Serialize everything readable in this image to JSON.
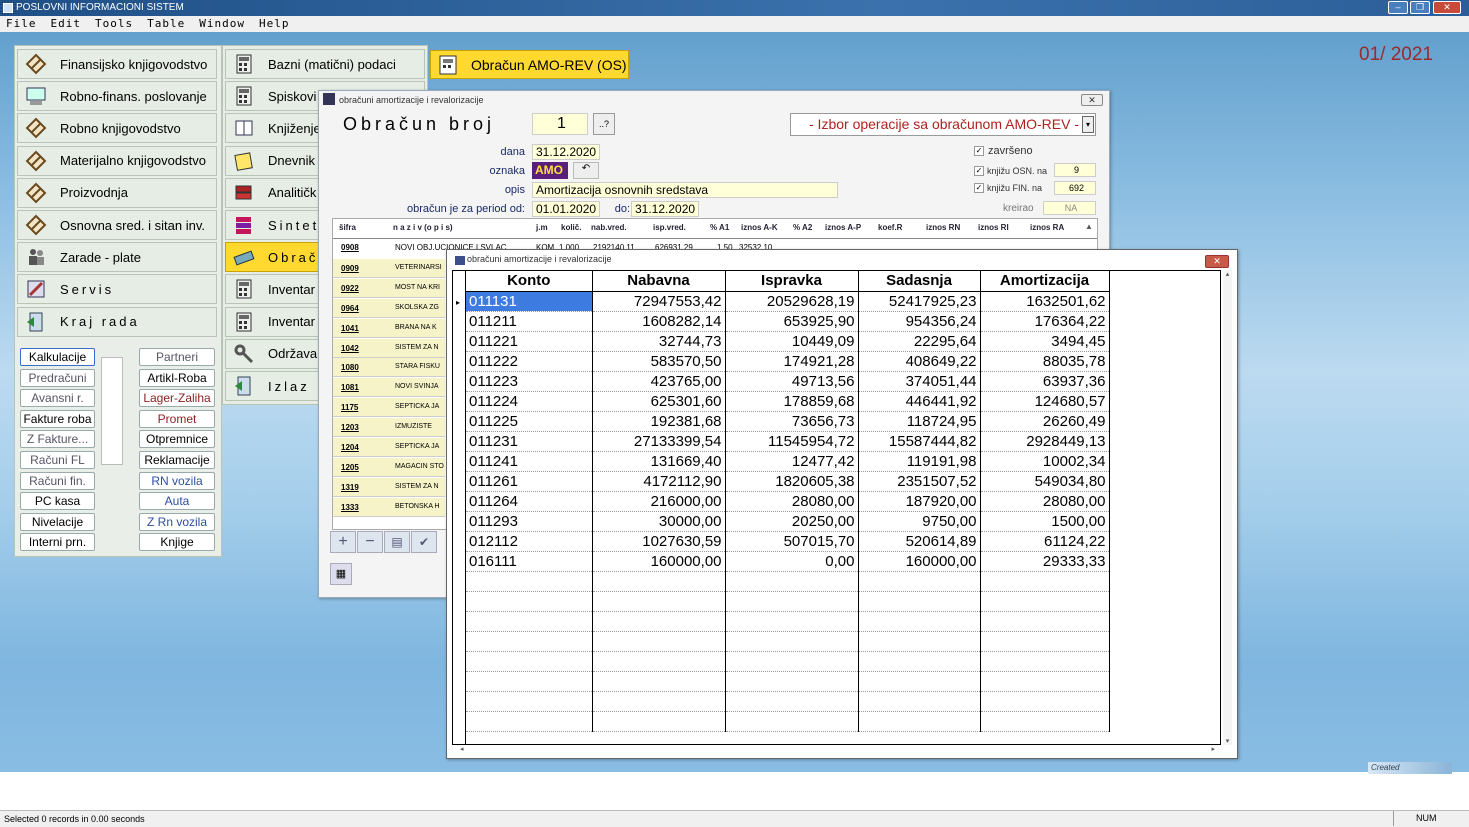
{
  "app": {
    "title": "POSLOVNI INFORMACIONI SISTEM",
    "period": "01/ 2021"
  },
  "menu": [
    "File",
    "Edit",
    "Tools",
    "Table",
    "Window",
    "Help"
  ],
  "col1": [
    {
      "label": "Finansijsko knjigovodstvo",
      "icon": "diamond-icon"
    },
    {
      "label": "Robno-finans. poslovanje",
      "icon": "computer-icon"
    },
    {
      "label": "Robno knjigovodstvo",
      "icon": "diamond-icon"
    },
    {
      "label": "Materijalno knjigovodstvo",
      "icon": "diamond-icon"
    },
    {
      "label": "Proizvodnja",
      "icon": "diamond-icon"
    },
    {
      "label": "Osnovna sred. i sitan inv.",
      "icon": "diamond-icon"
    },
    {
      "label": "Zarade - plate",
      "icon": "people-icon"
    },
    {
      "label": "Servis",
      "icon": "tools-icon"
    },
    {
      "label": "Kraj rada",
      "icon": "exit-icon"
    }
  ],
  "col2": [
    {
      "label": "Bazni (matični) podaci",
      "icon": "calculator-icon"
    },
    {
      "label": "Spiskovi",
      "icon": "calculator-icon"
    },
    {
      "label": "Knjiženje",
      "icon": "book-icon"
    },
    {
      "label": "Dnevnik",
      "icon": "notebook-icon"
    },
    {
      "label": "Analitičk",
      "icon": "books-icon"
    },
    {
      "label": "Sintet",
      "icon": "books-stack-icon"
    },
    {
      "label": "Obrač",
      "icon": "pen-icon"
    },
    {
      "label": "Inventar",
      "icon": "calculator-icon"
    },
    {
      "label": "Inventar",
      "icon": "calculator-icon"
    },
    {
      "label": "Održavan",
      "icon": "wrench-icon"
    },
    {
      "label": "Izlaz",
      "icon": "exit-icon"
    }
  ],
  "obracun_btn": "Obračun  AMO-REV (OS)",
  "small_left": [
    "Kalkulacije",
    "Predračuni",
    "Avansni r.",
    "Fakture roba",
    "Z Fakture...",
    "Računi FL",
    "Računi fin.",
    "PC kasa",
    "Nivelacije",
    "Interni prn."
  ],
  "small_right": [
    "Partneri",
    "Artikl-Roba",
    "Lager-Zaliha",
    "Promet",
    "Otpremnice",
    "Reklamacije",
    "RN vozila",
    "Auta",
    "Z Rn vozila",
    "Knjige"
  ],
  "back_win": {
    "title": "obračuni amortizacije i revalorizacije",
    "heading": "Obračun broj",
    "number": "1",
    "q": "..?",
    "combo": "- Izbor operacije sa obračunom AMO-REV -",
    "dana_l": "dana",
    "dana": "31.12.2020",
    "oznaka_l": "oznaka",
    "oznaka": "AMO",
    "opis_l": "opis",
    "opis": "Amortizacija osnovnih sredstava",
    "period_l": "obračun je za period od:",
    "od": "01.01.2020",
    "do_l": "do:",
    "do": "31.12.2020",
    "zavrseno": "završeno",
    "osn_l": "knjižu OSN. na",
    "osn": "9",
    "fin_l": "knjižu FIN. na",
    "fin": "692",
    "kreirao_l": "kreirao",
    "kreirao": "NA",
    "cols": [
      "šifra",
      "n a z i v  (o p i s)",
      "j.m",
      "količ.",
      "nab.vred.",
      "isp.vred.",
      "% A1",
      "iznos A-K",
      "% A2",
      "iznos A-P",
      "koef.R",
      "iznos RN",
      "iznos RI",
      "iznos RA"
    ],
    "first_row": [
      "0908",
      "NOVI OBJ.UCIONICE I SVLAC",
      "KOM",
      "1,000",
      "2192140,11",
      "626931,29",
      "1,50",
      "32532,10"
    ],
    "rows": [
      [
        "0909",
        "VETERINARSI"
      ],
      [
        "0922",
        "MOST NA KRI"
      ],
      [
        "0964",
        "SKOLSKA ZG"
      ],
      [
        "1041",
        "BRANA NA K"
      ],
      [
        "1042",
        "SISTEM ZA N"
      ],
      [
        "1080",
        "STARA FISKU"
      ],
      [
        "1081",
        "NOVI SVINJA"
      ],
      [
        "1175",
        "SEPTICKA JA"
      ],
      [
        "1203",
        "IZMUZISTE"
      ],
      [
        "1204",
        "SEPTICKA JA"
      ],
      [
        "1205",
        "MAGACIN STO"
      ],
      [
        "1319",
        "SISTEM ZA N"
      ],
      [
        "1333",
        "BETONSKA H"
      ]
    ]
  },
  "front_win": {
    "title": "obračuni amortizacije i revalorizacije",
    "cols": [
      "Konto",
      "Nabavna",
      "Ispravka",
      "Sadasnja",
      "Amortizacija"
    ],
    "rows": [
      [
        "011131",
        "72947553,42",
        "20529628,19",
        "52417925,23",
        "1632501,62"
      ],
      [
        "011211",
        "1608282,14",
        "653925,90",
        "954356,24",
        "176364,22"
      ],
      [
        "011221",
        "32744,73",
        "10449,09",
        "22295,64",
        "3494,45"
      ],
      [
        "011222",
        "583570,50",
        "174921,28",
        "408649,22",
        "88035,78"
      ],
      [
        "011223",
        "423765,00",
        "49713,56",
        "374051,44",
        "63937,36"
      ],
      [
        "011224",
        "625301,60",
        "178859,68",
        "446441,92",
        "124680,57"
      ],
      [
        "011225",
        "192381,68",
        "73656,73",
        "118724,95",
        "26260,49"
      ],
      [
        "011231",
        "27133399,54",
        "11545954,72",
        "15587444,82",
        "2928449,13"
      ],
      [
        "011241",
        "131669,40",
        "12477,42",
        "119191,98",
        "10002,34"
      ],
      [
        "011261",
        "4172112,90",
        "1820605,38",
        "2351507,52",
        "549034,80"
      ],
      [
        "011264",
        "216000,00",
        "28080,00",
        "187920,00",
        "28080,00"
      ],
      [
        "011293",
        "30000,00",
        "20250,00",
        "9750,00",
        "1500,00"
      ],
      [
        "012112",
        "1027630,59",
        "507015,70",
        "520614,89",
        "61124,22"
      ],
      [
        "016111",
        "160000,00",
        "0,00",
        "160000,00",
        "29333,33"
      ]
    ]
  },
  "created": "Created",
  "status": {
    "text": "Selected 0 records in 0.00 seconds",
    "num": "NUM"
  }
}
